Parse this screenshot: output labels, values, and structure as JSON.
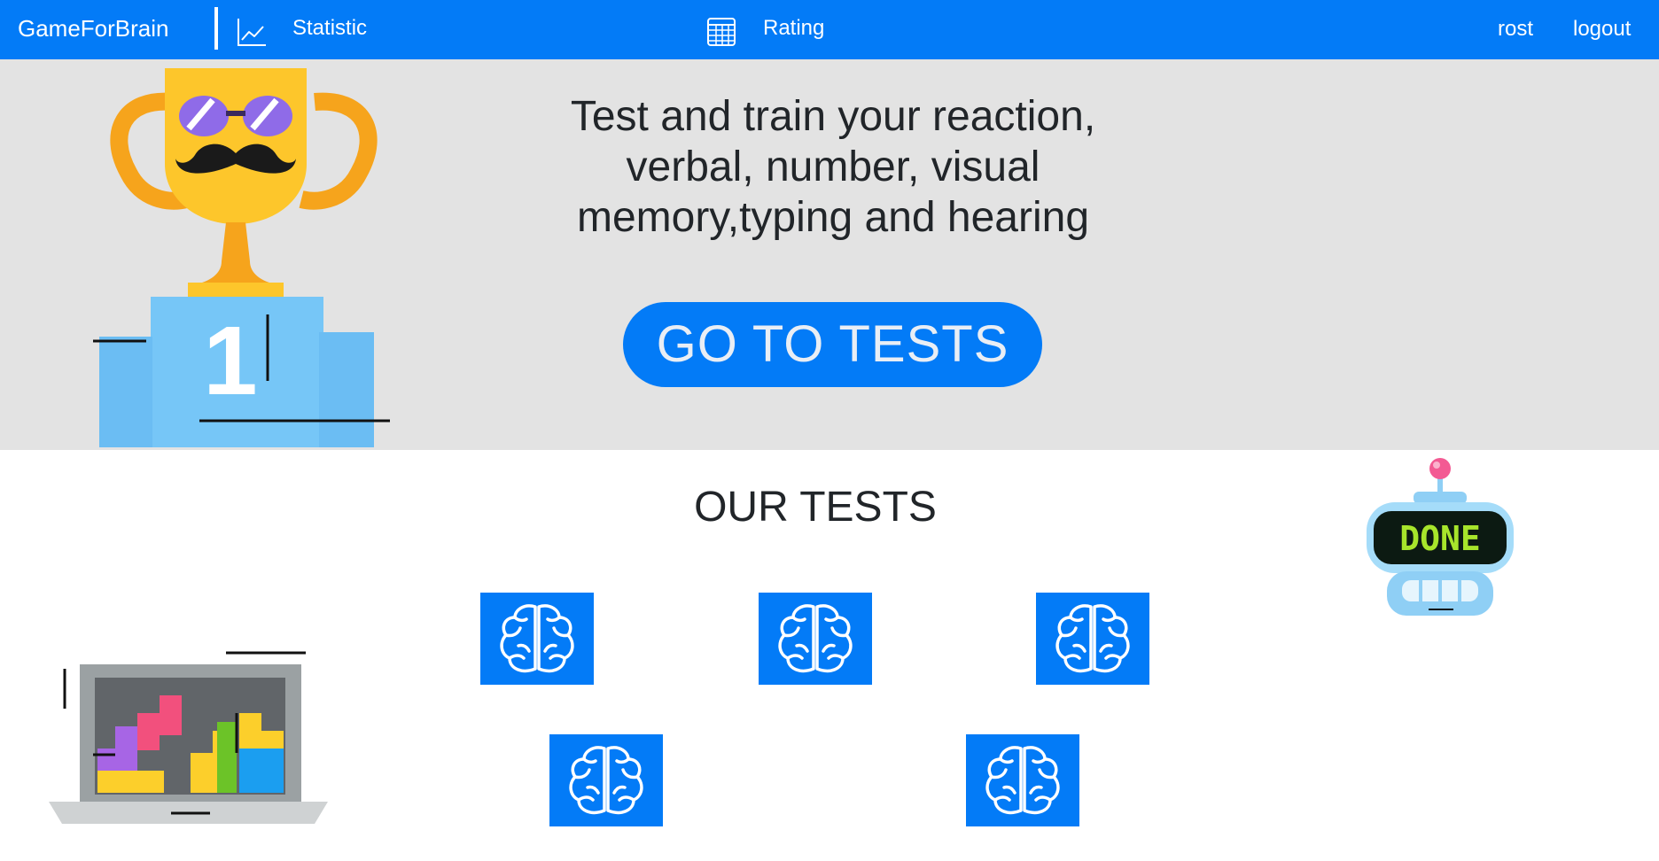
{
  "navbar": {
    "brand": "GameForBrain",
    "statistic_label": "Statistic",
    "rating_label": "Rating",
    "user_label": "rost",
    "logout_label": "logout",
    "accent_color": "#037bf7",
    "icons": [
      "chart-line-icon",
      "table-grid-icon"
    ]
  },
  "hero": {
    "headline_lines": [
      "Test and train your reaction,",
      "verbal, number, visual",
      "memory,typing and hearing"
    ],
    "cta_label": "GO TO TESTS",
    "background_color": "#e3e3e3",
    "illustration": "trophy-podium-illustration"
  },
  "tests_section": {
    "title": "OUR TESTS",
    "tests": [
      {
        "icon": "brain-icon"
      },
      {
        "icon": "brain-icon"
      },
      {
        "icon": "brain-icon"
      },
      {
        "icon": "brain-icon"
      },
      {
        "icon": "brain-icon"
      }
    ],
    "illustrations": [
      "robot-done-illustration",
      "tetris-laptop-illustration"
    ]
  }
}
